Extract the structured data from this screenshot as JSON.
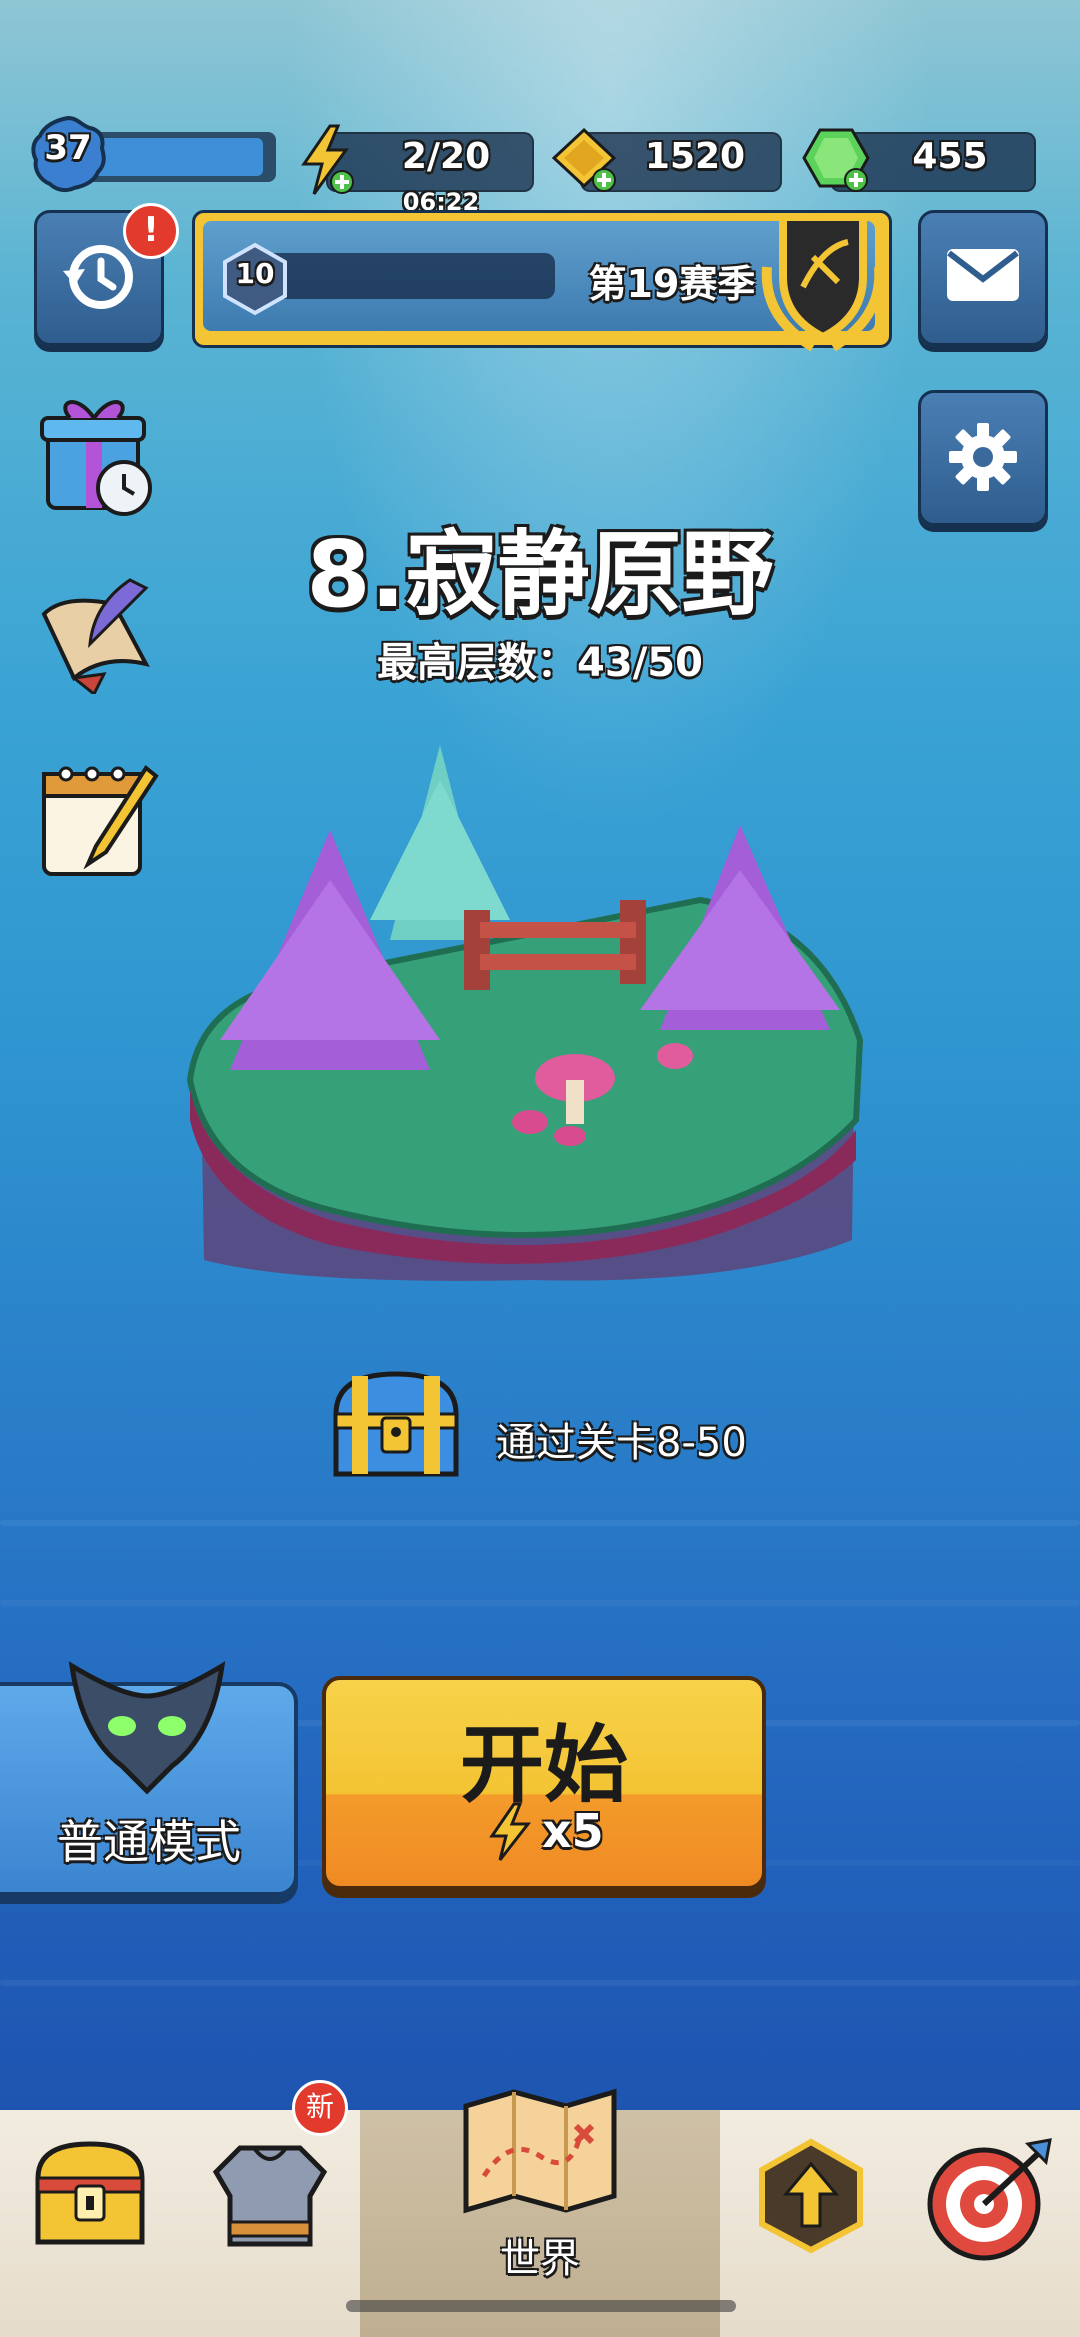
{
  "player": {
    "level": "37",
    "xp_fraction": 0.95
  },
  "energy": {
    "value": "2/20",
    "timer": "06:22"
  },
  "gold": {
    "value": "1520"
  },
  "gems": {
    "value": "455"
  },
  "season": {
    "level": "10",
    "label": "第19赛季"
  },
  "notifications": {
    "history_badge": "!"
  },
  "stage": {
    "title": "8.寂静原野",
    "best_label": "最高层数：43/50"
  },
  "reward": {
    "text": "通过关卡8-50"
  },
  "mode": {
    "label": "普通模式"
  },
  "start": {
    "label": "开始",
    "cost": "x5"
  },
  "nav": {
    "tabs": [
      {
        "name": "chest",
        "badge": ""
      },
      {
        "name": "equipment",
        "badge": "新"
      },
      {
        "name": "world",
        "label": "世界"
      },
      {
        "name": "upgrade"
      },
      {
        "name": "archery"
      }
    ]
  },
  "colors": {
    "gold": "#f3c433",
    "primary_blue": "#2f5d8e",
    "start_orange": "#f39b2a"
  }
}
